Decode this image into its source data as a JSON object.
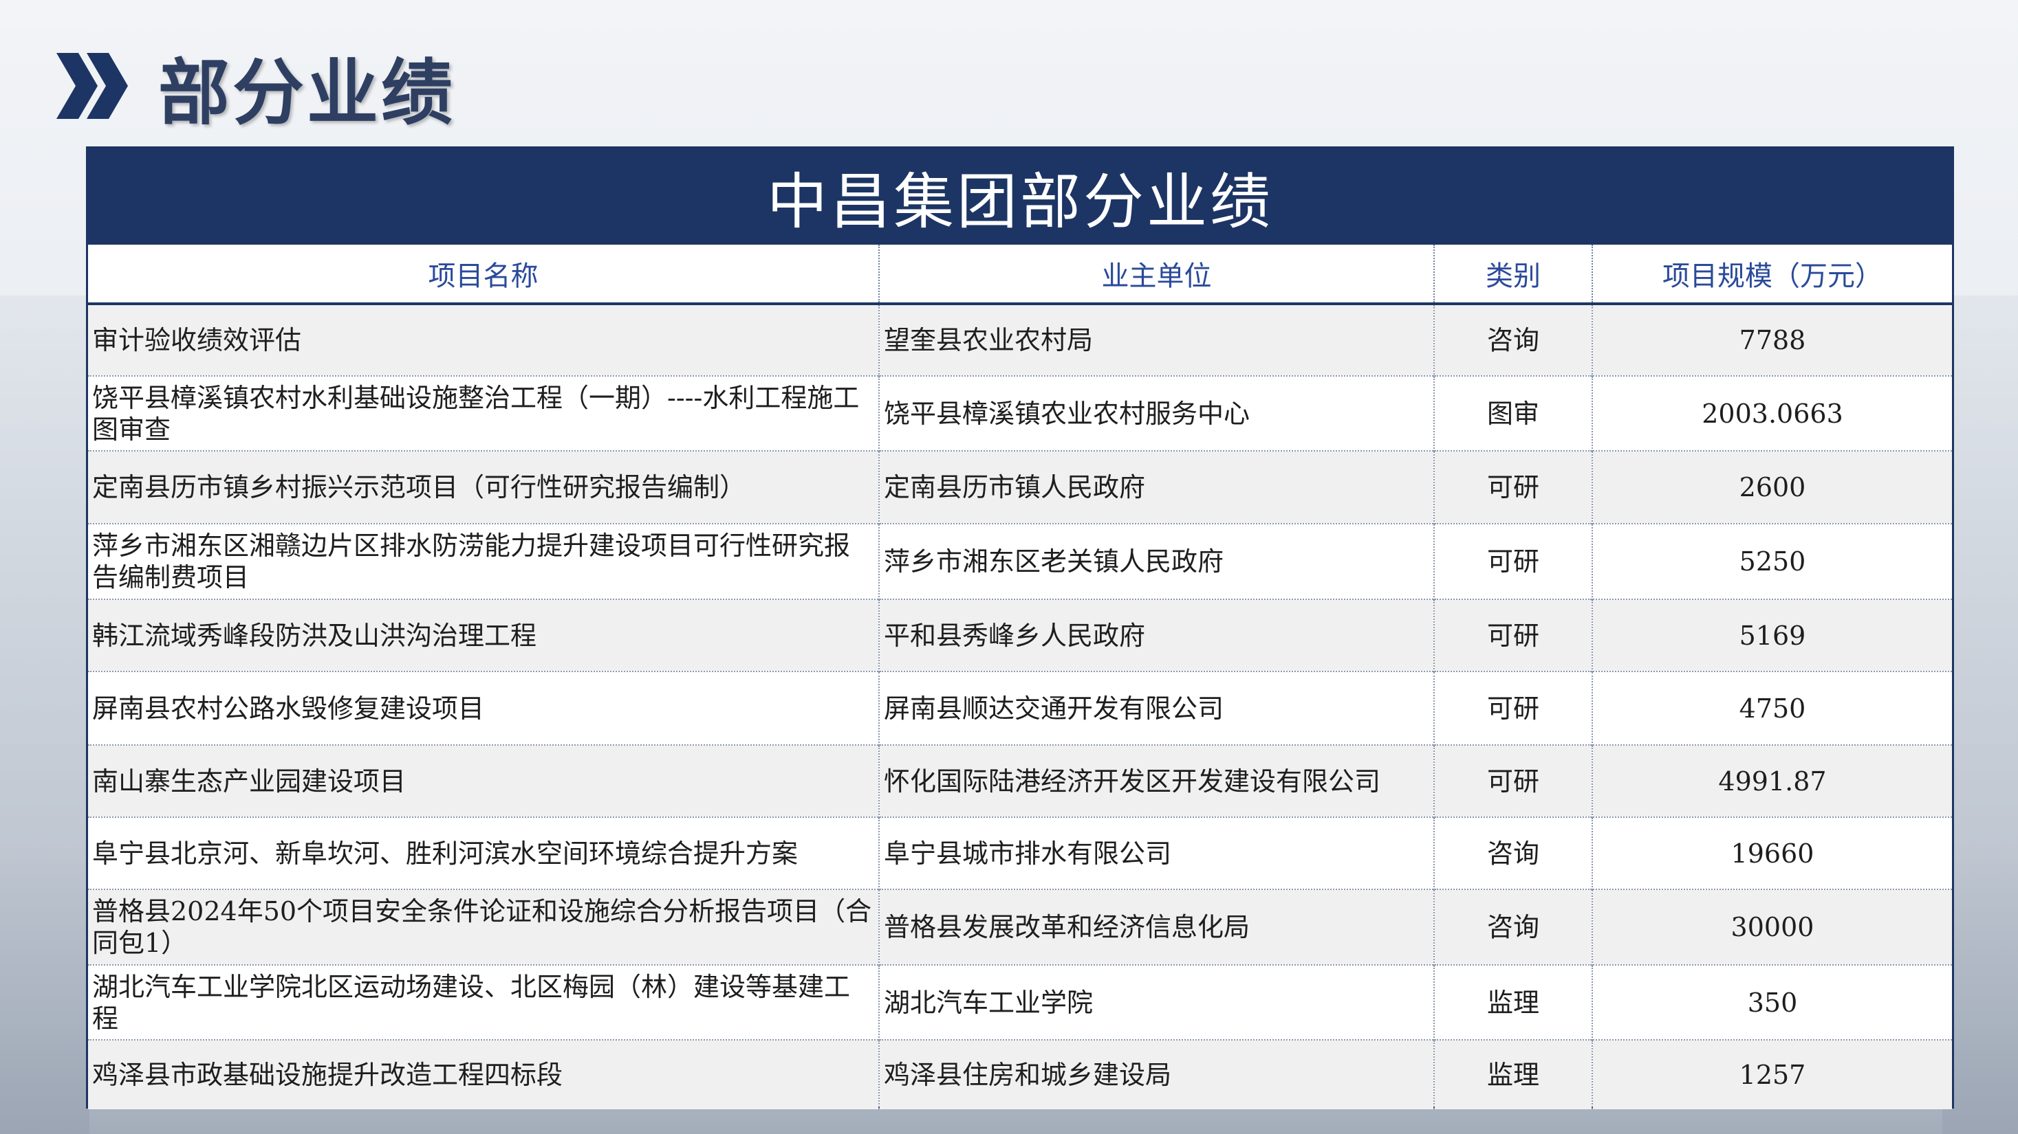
{
  "page": {
    "title": "部分业绩",
    "accent_color": "#1d3564",
    "header_text_color": "#2a4a9a",
    "icon": "double-chevron-right-icon"
  },
  "table": {
    "title": "中昌集团部分业绩",
    "headers": [
      "项目名称",
      "业主单位",
      "类别",
      "项目规模（万元）"
    ],
    "rows": [
      {
        "project": "审计验收绩效评估",
        "owner": "望奎县农业农村局",
        "category": "咨询",
        "scale": "7788"
      },
      {
        "project": "饶平县樟溪镇农村水利基础设施整治工程（一期）----水利工程施工图审查",
        "owner": "饶平县樟溪镇农业农村服务中心",
        "category": "图审",
        "scale": "2003.0663"
      },
      {
        "project": "定南县历市镇乡村振兴示范项目（可行性研究报告编制）",
        "owner": "定南县历市镇人民政府",
        "category": "可研",
        "scale": "2600"
      },
      {
        "project": "萍乡市湘东区湘赣边片区排水防涝能力提升建设项目可行性研究报告编制费项目",
        "owner": "萍乡市湘东区老关镇人民政府",
        "category": "可研",
        "scale": "5250"
      },
      {
        "project": "韩江流域秀峰段防洪及山洪沟治理工程",
        "owner": "平和县秀峰乡人民政府",
        "category": "可研",
        "scale": "5169"
      },
      {
        "project": "屏南县农村公路水毁修复建设项目",
        "owner": "屏南县顺达交通开发有限公司",
        "category": "可研",
        "scale": "4750"
      },
      {
        "project": "南山寨生态产业园建设项目",
        "owner": "怀化国际陆港经济开发区开发建设有限公司",
        "category": "可研",
        "scale": "4991.87"
      },
      {
        "project": "阜宁县北京河、新阜坎河、胜利河滨水空间环境综合提升方案",
        "owner": "阜宁县城市排水有限公司",
        "category": "咨询",
        "scale": "19660"
      },
      {
        "project": "普格县2024年50个项目安全条件论证和设施综合分析报告项目（合同包1）",
        "owner": "普格县发展改革和经济信息化局",
        "category": "咨询",
        "scale": "30000"
      },
      {
        "project": "湖北汽车工业学院北区运动场建设、北区梅园（林）建设等基建工程",
        "owner": " 湖北汽车工业学院",
        "category": "监理",
        "scale": "350"
      },
      {
        "project": "鸡泽县市政基础设施提升改造工程四标段",
        "owner": "鸡泽县住房和城乡建设局",
        "category": "监理",
        "scale": "1257"
      }
    ]
  }
}
